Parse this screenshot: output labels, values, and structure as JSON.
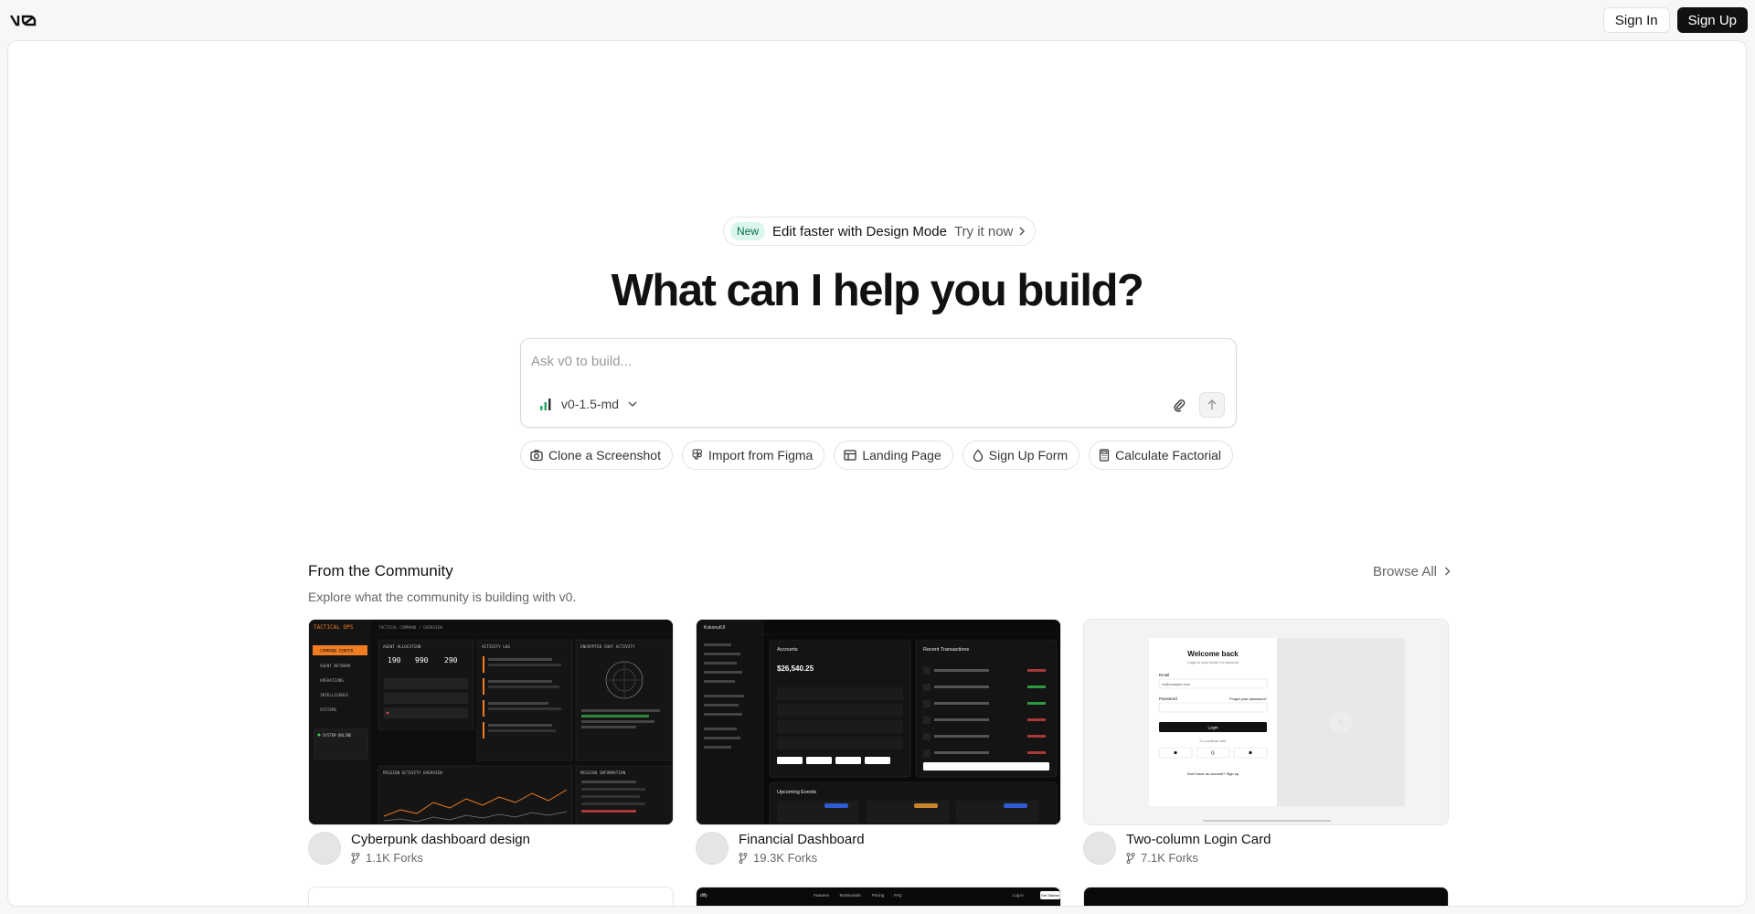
{
  "header": {
    "logo": "v0",
    "sign_in": "Sign In",
    "sign_up": "Sign Up"
  },
  "announcement": {
    "badge": "New",
    "text": "Edit faster with Design Mode",
    "cta": "Try it now"
  },
  "hero": {
    "title": "What can I help you build?"
  },
  "prompt": {
    "placeholder": "Ask v0 to build...",
    "model": "v0-1.5-md"
  },
  "chips": [
    {
      "label": "Clone a Screenshot",
      "icon": "camera-icon"
    },
    {
      "label": "Import from Figma",
      "icon": "figma-icon"
    },
    {
      "label": "Landing Page",
      "icon": "layout-icon"
    },
    {
      "label": "Sign Up Form",
      "icon": "droplet-icon"
    },
    {
      "label": "Calculate Factorial",
      "icon": "calculator-icon"
    }
  ],
  "community": {
    "title": "From the Community",
    "subtitle": "Explore what the community is building with v0.",
    "browse_all": "Browse All",
    "cards": [
      {
        "title": "Cyberpunk dashboard design",
        "forks": "1.1K Forks"
      },
      {
        "title": "Financial Dashboard",
        "forks": "19.3K Forks"
      },
      {
        "title": "Two-column Login Card",
        "forks": "7.1K Forks"
      }
    ]
  },
  "thumbs": {
    "cyber": {
      "brand": "TACTICAL OPS",
      "nav": [
        "COMMAND CENTER",
        "AGENT NETWORK",
        "OPERATIONS",
        "INTELLIGENCE",
        "SYSTEMS"
      ],
      "status": "SYSTEM ONLINE",
      "breadcrumb": "TACTICAL COMMAND / OVERVIEW",
      "panel1": "AGENT ALLOCATION",
      "stats": [
        "190",
        "990",
        "290"
      ],
      "panel2": "ACTIVITY LOG",
      "panel3": "ENCRYPTED CHAT ACTIVITY",
      "panel4": "MISSION ACTIVITY OVERVIEW",
      "panel5": "MISSION INFORMATION"
    },
    "finance": {
      "brand": "KokonutUI",
      "accounts": "Accounts",
      "balance": "$26,540.25",
      "recent": "Recent Transactions",
      "events": "Upcoming Events"
    },
    "login": {
      "title": "Welcome back",
      "subtitle": "Login to your Acme Inc account",
      "email_label": "Email",
      "email_placeholder": "m@example.com",
      "password_label": "Password",
      "forgot": "Forgot your password?",
      "button": "Login",
      "divider": "Or continue with",
      "signup": "Don't have an account? Sign up"
    },
    "row2_nav": [
      "Features",
      "Testimonials",
      "Pricing",
      "FAQ"
    ],
    "row2_login": "Log in",
    "row2_cta": "Get Started"
  }
}
